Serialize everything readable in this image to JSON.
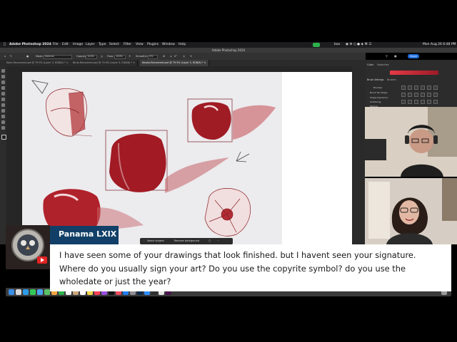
{
  "menubar": {
    "app_name": "Adobe Photoshop 2024",
    "items": [
      "File",
      "Edit",
      "Image",
      "Layer",
      "Type",
      "Select",
      "Filter",
      "View",
      "Plugins",
      "Window",
      "Help"
    ],
    "clock": "Mon Aug 26  6:48 PM"
  },
  "photoshop": {
    "window_title": "Adobe Photoshop 2024",
    "options": {
      "mode_label": "Mode:",
      "mode_value": "Normal",
      "opacity_label": "Opacity:",
      "opacity_value": "100%",
      "flow_label": "Flow:",
      "flow_value": "100%",
      "smoothing_label": "Smoothing:",
      "smoothing_value": "0%",
      "angle_value": "0°"
    },
    "share_button": "Share",
    "tabs": [
      {
        "label": "Kolin-Recovered.psd @ 79.9% (Layer 3, RGB/8) *"
      },
      {
        "label": "Birds-Recovered.psd @ 79.9% (Layer 3, RGB/8) *"
      },
      {
        "label": "Kesolo-Recovered.psd @ 79.9% (Layer 3, RGB/8) *"
      }
    ],
    "panels": {
      "color_tab": "Color",
      "swatches_tab": "Swatches",
      "brush_settings_tab": "Brush Settings",
      "brushes_tab": "Brushes",
      "brush_rows": [
        "Brushes",
        "Brush Tip Shape",
        "Shape Dynamics",
        "Scattering",
        "Texture"
      ]
    },
    "contextual_bar": {
      "select_subject": "Select subject",
      "remove_background": "Remove background"
    },
    "accent_color": "#1e6fe0"
  },
  "comment": {
    "author": "Panama LXIX",
    "text": "I have seen some of your drawings that look finished. but I havent seen your signature. Where do you usually sign your art? Do you use the copyrite symbol? do you use the wholedate or just the year?",
    "name_bar_color": "#123f67"
  },
  "dock": {
    "icons": [
      "finder-icon",
      "launchpad-icon",
      "safari-icon",
      "messages-icon",
      "mail-icon",
      "maps-icon",
      "photos-icon",
      "facetime-icon",
      "calendar-icon",
      "contacts-icon",
      "reminders-icon",
      "notes-icon",
      "music-icon",
      "podcasts-icon",
      "tv-icon",
      "news-icon",
      "appstore-icon",
      "settings-icon",
      "photoshop-icon",
      "zoom-icon",
      "obs-icon",
      "chrome-icon",
      "slack-icon",
      "trash-icon"
    ]
  }
}
